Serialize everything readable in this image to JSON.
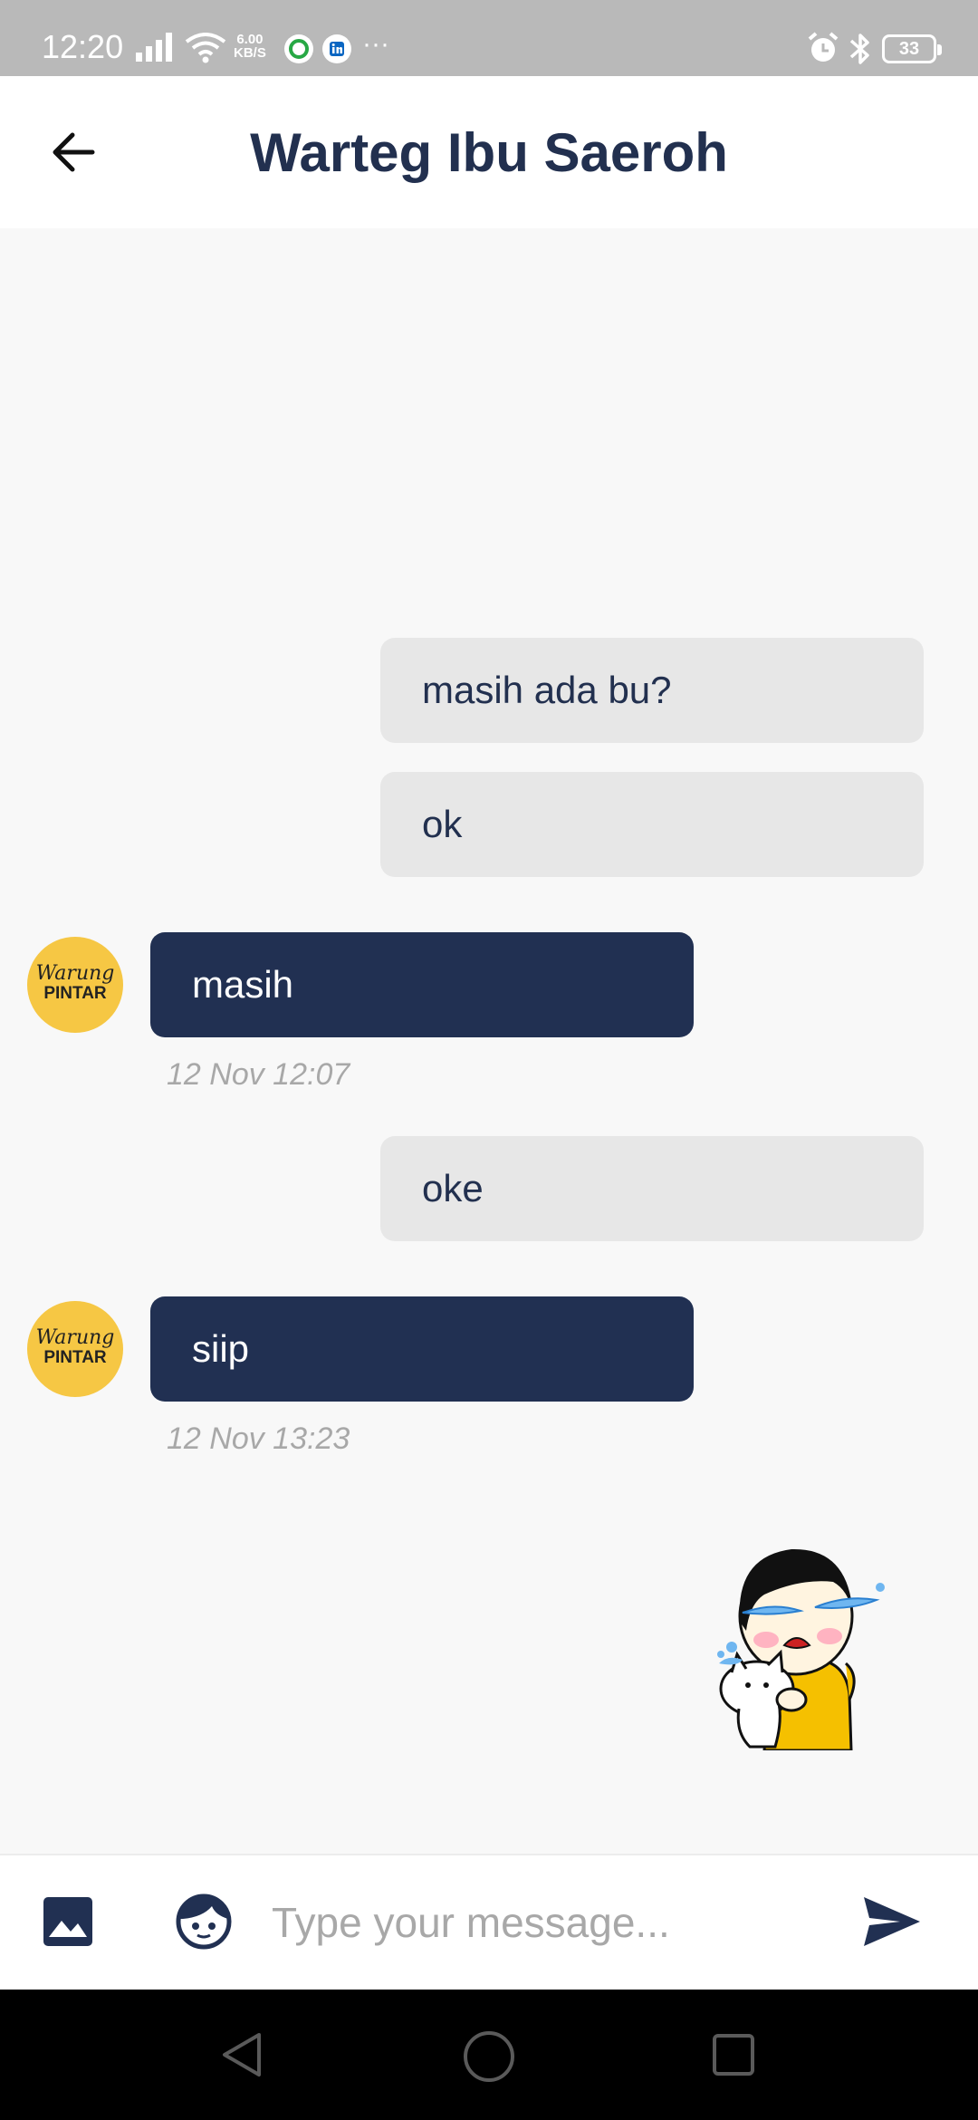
{
  "status_bar": {
    "time": "12:20",
    "net_speed_value": "6.00",
    "net_speed_unit": "KB/S",
    "more": "···",
    "battery": "33"
  },
  "header": {
    "title": "Warteg Ibu Saeroh",
    "back_icon": "arrow-left-icon"
  },
  "messages": [
    {
      "direction": "outgoing",
      "text": "masih ada bu?"
    },
    {
      "direction": "outgoing",
      "text": "ok"
    },
    {
      "direction": "incoming",
      "text": "masih",
      "time": "12 Nov 12:07",
      "avatar_script": "Warung",
      "avatar_brand": "PINTAR"
    },
    {
      "direction": "outgoing",
      "text": "oke"
    },
    {
      "direction": "incoming",
      "text": "siip",
      "time": "12 Nov 13:23",
      "avatar_script": "Warung",
      "avatar_brand": "PINTAR"
    },
    {
      "direction": "outgoing",
      "type": "sticker",
      "sticker": "crying-girl-with-cat-sticker"
    }
  ],
  "composer": {
    "placeholder": "Type your message...",
    "image_icon": "image-icon",
    "emoji_icon": "emoji-face-icon",
    "send_icon": "send-icon"
  },
  "nav_bar": {
    "back_icon": "nav-back-icon",
    "home_icon": "nav-home-icon",
    "recents_icon": "nav-recents-icon"
  },
  "colors": {
    "primary": "#213052",
    "outgoing_bubble": "#e7e7e7",
    "avatar_bg": "#f6c744",
    "timestamp": "#a8a8a8"
  }
}
